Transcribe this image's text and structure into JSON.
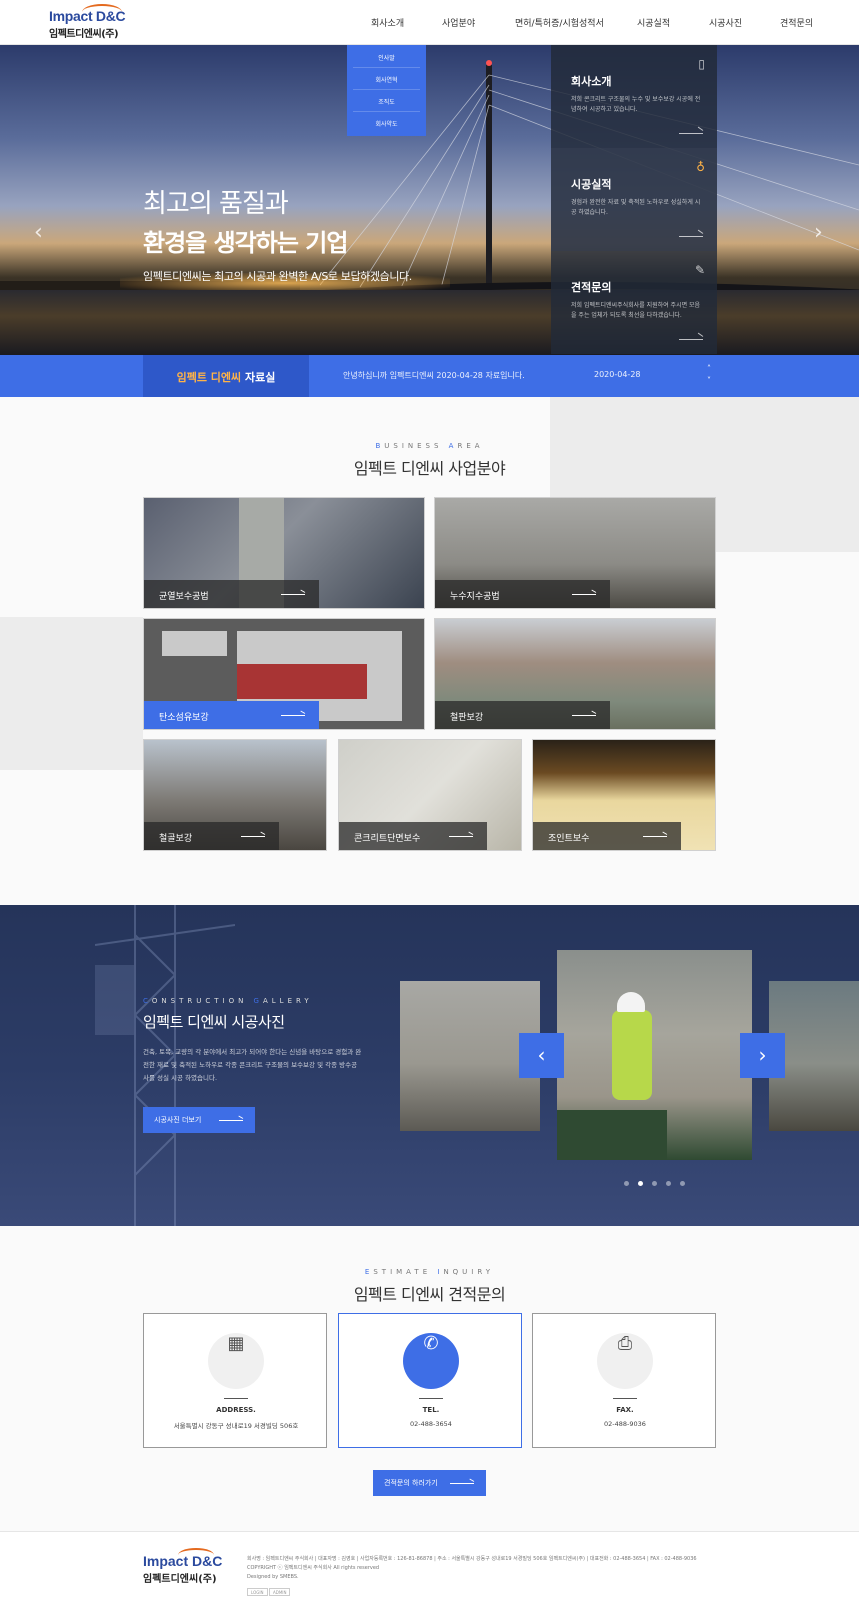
{
  "header": {
    "logo_en": "Impact D&C",
    "logo_ko": "임펙트디엔씨(주)",
    "nav": [
      "회사소개",
      "사업분야",
      "면허/특허증/시험성적서",
      "시공실적",
      "시공사진",
      "견적문의"
    ]
  },
  "dropdown": {
    "items": [
      "인사말",
      "회사연혁",
      "조직도",
      "회사약도"
    ]
  },
  "hero": {
    "title_line1": "최고의 품질과",
    "title_line2": "환경을 생각하는 기업",
    "subtitle": "임펙트디엔씨는 최고의 시공과 완벽한 A/S로 보답하겠습니다.",
    "prev_arrow": "‹",
    "next_arrow": "›",
    "panels": [
      {
        "title": "회사소개",
        "desc": "저희 콘크리트 구조물의 누수 및 보수보강 시공에 전념하여 시공하고 있습니다.",
        "icon": "phone-icon"
      },
      {
        "title": "시공실적",
        "desc": "경험과 완전한 자료 및 축적된 노하우로 성실하게 시공 하였습니다.",
        "icon": "bulb-icon"
      },
      {
        "title": "견적문의",
        "desc": "저희 임펙트디엔씨주식회사를 지원하여 주시면 모음을 주는 업체가 되도록 최선을 다하겠습니다.",
        "icon": "pencil-icon"
      }
    ],
    "colors": {
      "panel_dark": "#222a3a",
      "panel_mid": "#2e3648"
    }
  },
  "notice": {
    "label_highlight": "임펙트 디엔씨",
    "label_rest": " 자료실",
    "text": "안녕하십니까 임펙트디엔씨 2020-04-28 자료입니다.",
    "date": "2020-04-28",
    "up": "˄",
    "down": "˅"
  },
  "business": {
    "eyebrow": "BUSINESS AREA",
    "title": "임펙트 디엔씨 사업분야",
    "tiles": [
      "균열보수공법",
      "누수지수공법",
      "탄소섬유보강",
      "철판보강",
      "철골보강",
      "콘크리트단면보수",
      "조인트보수"
    ]
  },
  "gallery": {
    "eyebrow": "CONSTRUCTION GALLERY",
    "title": "임펙트 디엔씨 시공사진",
    "desc": "건축, 토목, 교량의 각 분야에서 최고가 되어야 한다는 신념을 바탕으로 경험과 완전한 재료 및 축적된 노하우로 각종 콘크리트 구조물의 보수보강 및 각종 방수공사를 성실 시공 하였습니다.",
    "button": "시공사진 더보기",
    "prev_arrow": "‹",
    "next_arrow": "›",
    "slide_count": 5,
    "active_dot": 2
  },
  "estimate": {
    "eyebrow": "ESTIMATE INQUIRY",
    "title": "임펙트 디엔씨 견적문의",
    "cards": [
      {
        "label": "ADDRESS.",
        "value": "서울특별시 강동구 성내로19 서경빌딩 506호",
        "icon": "building-icon",
        "glyph": "▦"
      },
      {
        "label": "TEL.",
        "value": "02-488-3654",
        "icon": "phone-icon",
        "glyph": "✆"
      },
      {
        "label": "FAX.",
        "value": "02-488-9036",
        "icon": "fax-icon",
        "glyph": "⎙"
      }
    ],
    "button": "견적문의 하러가기"
  },
  "footer": {
    "logo_en": "Impact D&C",
    "logo_ko": "임펙트디엔씨(주)",
    "line1": "회사명 : 임펙트디엔씨 주식회사 | 대표자명 : 김영호 | 사업자등록번호 : 126-81-86878 | 주소 : 서울특별시 강동구 성내로19 서경빌딩 506호 임펙트디엔씨(주) | 대표전화 : 02-488-3654 | FAX : 02-488-9036",
    "line2": "COPYRIGHT ⓒ 임펙트디엔씨 주식회사 All rights reserved",
    "line3": "Designed by SMEBS.",
    "badges": [
      "LOGIN",
      "ADMIN"
    ]
  },
  "accent": "#3e6ee6"
}
